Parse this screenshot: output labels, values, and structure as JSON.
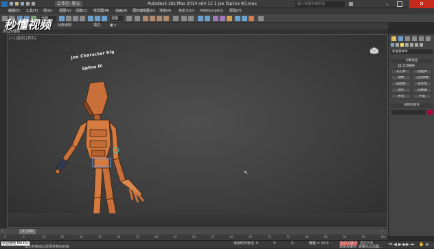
{
  "titlebar": {
    "workspace": "工作区: 默认",
    "title": "Autodesk 3ds Max 2014 x64    13 1 joe (Spline IK).max",
    "search_placeholder": "键入关键字或短语"
  },
  "menu": [
    "编辑(E)",
    "工具(T)",
    "组(G)",
    "视图(V)",
    "创建(C)",
    "修改器(M)",
    "动画(A)",
    "图形编辑器(D)",
    "渲染(R)",
    "自定义(U)",
    "MAXScript(X)",
    "帮助(H)"
  ],
  "toolbar": {
    "selection_set": "全部",
    "view_select": "视图"
  },
  "ribbon": {
    "tabs": [
      "建模",
      "自由形式",
      "选择",
      "对象绘制",
      "填充"
    ],
    "sub": "多边形建模"
  },
  "viewport": {
    "label": "[+] [透视] [真实]"
  },
  "scene": {
    "sign_line1": "Joe Character Rig",
    "sign_line2": "Spline IK"
  },
  "command_panel": {
    "tabs": [
      "create-tab",
      "modify-tab",
      "hierarchy-tab",
      "motion-tab",
      "display-tab",
      "utilities-tab"
    ],
    "category_select": "标准基本体",
    "object_type_header": "对象类型",
    "autogrid": "自动栅格",
    "buttons": [
      "长方体",
      "圆锥体",
      "球体",
      "几何球体",
      "圆柱体",
      "管状体",
      "圆环",
      "四棱锥",
      "茶壶",
      "平面"
    ],
    "name_color_header": "名称和颜色",
    "name_color_swatch": "#b0003a"
  },
  "timeline": {
    "frame": "0 / 100"
  },
  "ruler_ticks": [
    "0",
    "5",
    "10",
    "15",
    "20",
    "25",
    "30",
    "35",
    "40",
    "45",
    "50",
    "55",
    "60",
    "65",
    "70",
    "75",
    "80",
    "85",
    "90",
    "95",
    "100"
  ],
  "status": {
    "welcome": "欢迎使用 MAXSc",
    "prompt": "单击并拖动以选择并移动对象",
    "add_time_tag": "添加时间标记",
    "x_label": "X:",
    "y_label": "Y:",
    "z_label": "Z:",
    "grid": "栅格 = 10.0",
    "auto_key": "自动关键点",
    "selected": "选定对象",
    "set_key": "设置关键点",
    "key_filters": "关键点过滤器..."
  },
  "watermark": "秒懂视频",
  "accent": "#ff8c2a"
}
